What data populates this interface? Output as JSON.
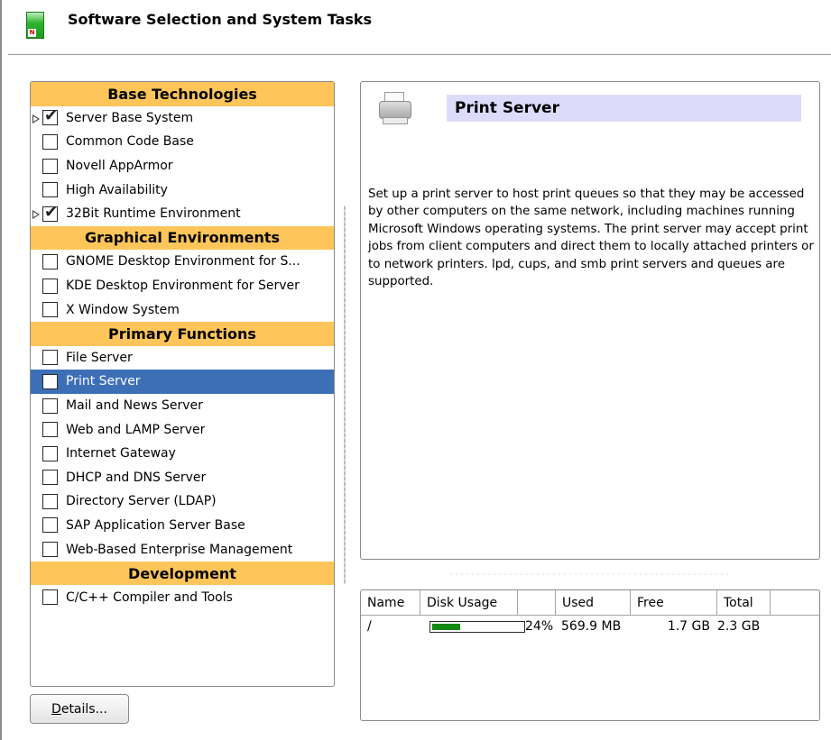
{
  "window": {
    "title": "Software Selection and System Tasks",
    "icon": "yast-software-icon",
    "icon_badge": "N"
  },
  "categories": [
    {
      "label": "Base Technologies",
      "items": [
        {
          "label": "Server Base System",
          "checked": true,
          "has_tag": true
        },
        {
          "label": "Common Code Base",
          "checked": false
        },
        {
          "label": "Novell AppArmor",
          "checked": false
        },
        {
          "label": "High Availability",
          "checked": false
        },
        {
          "label": "32Bit Runtime Environment",
          "checked": true,
          "has_tag": true
        }
      ]
    },
    {
      "label": "Graphical Environments",
      "items": [
        {
          "label": "GNOME Desktop Environment for S...",
          "checked": false
        },
        {
          "label": "KDE Desktop Environment for Server",
          "checked": false
        },
        {
          "label": "X Window System",
          "checked": false
        }
      ]
    },
    {
      "label": "Primary Functions",
      "items": [
        {
          "label": "File Server",
          "checked": false
        },
        {
          "label": "Print Server",
          "checked": false,
          "selected": true
        },
        {
          "label": "Mail and News Server",
          "checked": false
        },
        {
          "label": "Web and LAMP Server",
          "checked": false
        },
        {
          "label": "Internet Gateway",
          "checked": false
        },
        {
          "label": "DHCP and DNS Server",
          "checked": false
        },
        {
          "label": "Directory Server (LDAP)",
          "checked": false
        },
        {
          "label": "SAP Application Server Base",
          "checked": false
        },
        {
          "label": "Web-Based Enterprise Management",
          "checked": false
        }
      ]
    },
    {
      "label": "Development",
      "items": [
        {
          "label": "C/C++ Compiler and Tools",
          "checked": false
        }
      ]
    }
  ],
  "details_button": {
    "label_mnemonic": "D",
    "label_rest": "etails..."
  },
  "description": {
    "icon": "printer-icon",
    "heading": "Print Server",
    "text": "Set up a print server to host print queues so that they may be accessed by other computers on the same network, including machines running Microsoft Windows operating systems. The print server may accept print jobs from client computers and direct them to locally attached printers or to network printers. lpd, cups, and smb print servers and queues are supported."
  },
  "disk_usage": {
    "columns": [
      "Name",
      "Disk Usage",
      "",
      "Used",
      "Free",
      "Total"
    ],
    "rows": [
      {
        "name": "/",
        "percent_label": "24%",
        "fill_fraction": 0.24,
        "used": "569.9 MB",
        "free": "1.7 GB",
        "total": "2.3 GB"
      }
    ]
  },
  "colors": {
    "category_bg": "#fdc55a",
    "selection_bg": "#3d6fb7",
    "heading_bg": "#dcdcfa",
    "usage_fill": "#138a13"
  }
}
